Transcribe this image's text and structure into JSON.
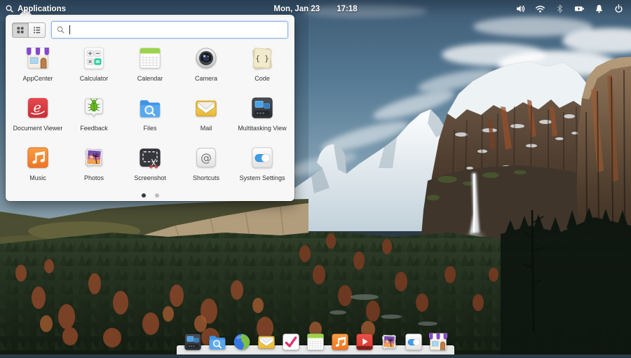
{
  "panel": {
    "app_menu": {
      "label": "Applications",
      "icon": "search-icon"
    },
    "clock": {
      "date": "Mon, Jan 23",
      "time": "17:18"
    },
    "indicators": [
      {
        "id": "volume",
        "icon": "volume-icon",
        "symbol": "sym-volume",
        "dimmed": false
      },
      {
        "id": "wifi",
        "icon": "wifi-icon",
        "symbol": "sym-wifi",
        "dimmed": false
      },
      {
        "id": "bluetooth",
        "icon": "bluetooth-icon",
        "symbol": "sym-bluetooth",
        "dimmed": true
      },
      {
        "id": "battery",
        "icon": "battery-charging-icon",
        "symbol": "sym-battery",
        "dimmed": false
      },
      {
        "id": "notifications",
        "icon": "bell-icon",
        "symbol": "sym-bell",
        "dimmed": false
      },
      {
        "id": "power",
        "icon": "power-icon",
        "symbol": "sym-power",
        "dimmed": false
      }
    ]
  },
  "launcher": {
    "view_toggle": [
      {
        "id": "grid-view",
        "icon": "grid-view-icon",
        "symbol": "sym-grid-view",
        "active": true
      },
      {
        "id": "list-view",
        "icon": "list-view-icon",
        "symbol": "sym-list-view",
        "active": false
      }
    ],
    "search": {
      "value": "",
      "placeholder": ""
    },
    "apps": [
      {
        "id": "appcenter",
        "label": "AppCenter",
        "symbol": "sym-appcenter"
      },
      {
        "id": "calculator",
        "label": "Calculator",
        "symbol": "sym-calculator"
      },
      {
        "id": "calendar",
        "label": "Calendar",
        "symbol": "sym-calendar"
      },
      {
        "id": "camera",
        "label": "Camera",
        "symbol": "sym-camera"
      },
      {
        "id": "code",
        "label": "Code",
        "symbol": "sym-code"
      },
      {
        "id": "document-viewer",
        "label": "Document Viewer",
        "symbol": "sym-docviewer"
      },
      {
        "id": "feedback",
        "label": "Feedback",
        "symbol": "sym-feedback"
      },
      {
        "id": "files",
        "label": "Files",
        "symbol": "sym-files"
      },
      {
        "id": "mail",
        "label": "Mail",
        "symbol": "sym-mail"
      },
      {
        "id": "multitasking-view",
        "label": "Multitasking View",
        "symbol": "sym-multitasking"
      },
      {
        "id": "music",
        "label": "Music",
        "symbol": "sym-music"
      },
      {
        "id": "photos",
        "label": "Photos",
        "symbol": "sym-photos"
      },
      {
        "id": "screenshot",
        "label": "Screenshot",
        "symbol": "sym-screenshot"
      },
      {
        "id": "shortcuts",
        "label": "Shortcuts",
        "symbol": "sym-shortcuts"
      },
      {
        "id": "system-settings",
        "label": "System Settings",
        "symbol": "sym-settings"
      }
    ],
    "pager": {
      "pages": 2,
      "active_index": 0
    }
  },
  "dock": {
    "items": [
      {
        "id": "multitasking-view",
        "symbol": "sym-multitasking"
      },
      {
        "id": "files",
        "symbol": "sym-files"
      },
      {
        "id": "web-browser",
        "symbol": "sym-web"
      },
      {
        "id": "mail",
        "symbol": "sym-mail"
      },
      {
        "id": "tasks",
        "symbol": "sym-tasks"
      },
      {
        "id": "calendar",
        "symbol": "sym-calendar"
      },
      {
        "id": "music",
        "symbol": "sym-music"
      },
      {
        "id": "videos",
        "symbol": "sym-videos"
      },
      {
        "id": "photos",
        "symbol": "sym-photos"
      },
      {
        "id": "system-settings",
        "symbol": "sym-settings"
      },
      {
        "id": "appcenter",
        "symbol": "sym-appcenter"
      }
    ]
  },
  "colors": {
    "accent_blue": "#3689e6",
    "search_border": "#8ab4e8",
    "panel_text": "#ffffff",
    "dock_shelf": "rgba(248,248,249,0.93)"
  }
}
